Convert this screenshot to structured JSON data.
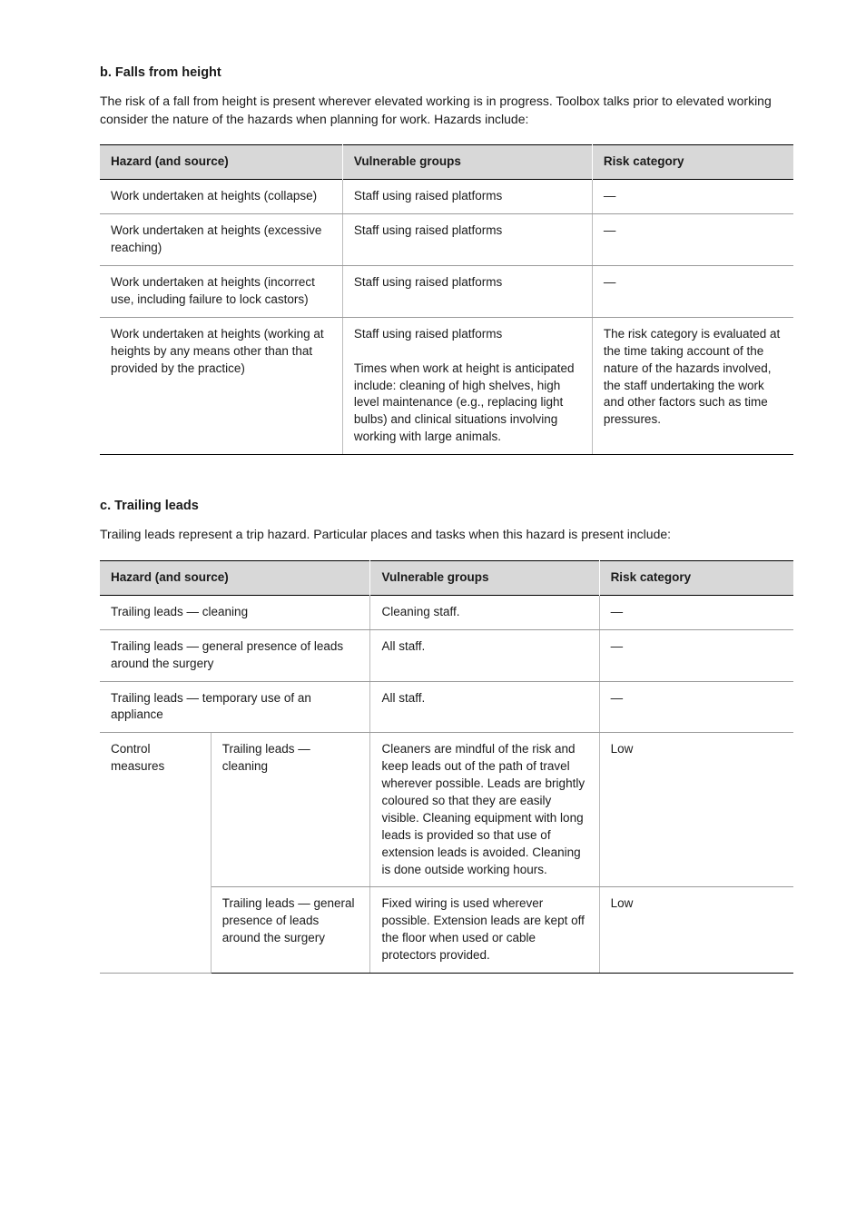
{
  "section1": {
    "heading_num": "b.",
    "heading_text": "Falls from height",
    "body": "The risk of a fall from height is present wherever elevated working is in progress. Toolbox talks prior to elevated working consider the nature of the hazards when planning for work. Hazards include:"
  },
  "table1": {
    "headers": [
      "Hazard (and source)",
      "Vulnerable groups",
      "Risk category"
    ],
    "rows": [
      {
        "c1": "Work undertaken at heights (collapse)",
        "c2": "Staff using raised platforms",
        "c3": "—"
      },
      {
        "c1": "Work undertaken at heights (excessive reaching)",
        "c2": "Staff using raised platforms",
        "c3": "—"
      },
      {
        "c1": "Work undertaken at heights (incorrect use, including failure to lock castors)",
        "c2": "Staff using raised platforms",
        "c3": "—"
      },
      {
        "c1": "Work undertaken at heights (working at heights by any means other than that provided by the practice)",
        "c2": "Staff using raised platforms\n\nTimes when work at height is anticipated include: cleaning of high shelves, high level maintenance (e.g., replacing light bulbs) and clinical situations involving working with large animals.",
        "c3": "The risk category is evaluated at the time taking account of the nature of the hazards involved, the staff undertaking the work and other factors such as time pressures."
      }
    ]
  },
  "section2": {
    "heading_num": "c.",
    "heading_text": "Trailing leads",
    "body": "Trailing leads represent a trip hazard. Particular places and tasks when this hazard is present include:"
  },
  "table2": {
    "headers_merged": "Hazard (and source)",
    "headers": [
      "Vulnerable groups",
      "Risk category"
    ],
    "rows": [
      {
        "span2": "Trailing leads — cleaning",
        "c3": "Cleaning staff.",
        "c4": "—"
      },
      {
        "span2": "Trailing leads — general presence of leads around the surgery",
        "c3": "All staff.",
        "c4": "—"
      },
      {
        "span2": "Trailing leads — temporary use of an appliance",
        "c3": "All staff.",
        "c4": "—"
      }
    ],
    "controls_label": "Control measures",
    "controls": [
      {
        "label": "Trailing leads — cleaning",
        "text": "Cleaners are mindful of the risk and keep leads out of the path of travel wherever possible. Leads are brightly coloured so that they are easily visible. Cleaning equipment with long leads is provided so that use of extension leads is avoided. Cleaning is done outside working hours.",
        "cat": "Low"
      },
      {
        "label": "Trailing leads — general presence of leads around the surgery",
        "text": "Fixed wiring is used wherever possible. Extension leads are kept off the floor when used or cable protectors provided.",
        "cat": "Low"
      }
    ]
  }
}
